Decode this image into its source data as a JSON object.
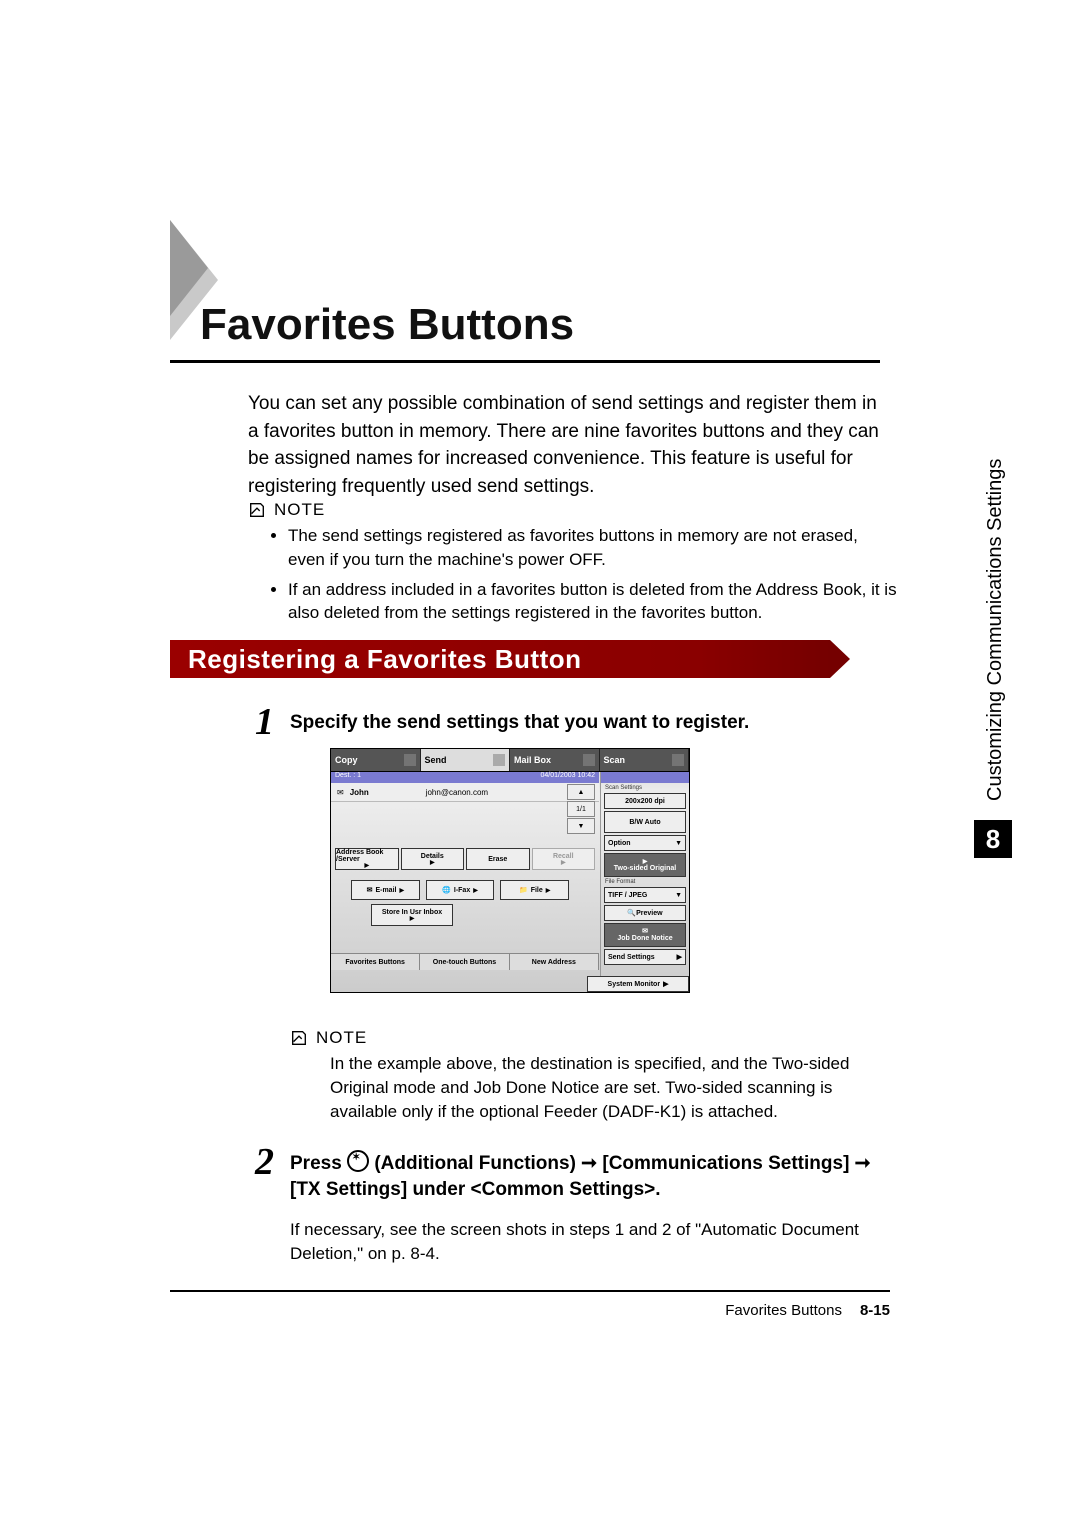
{
  "title": "Favorites Buttons",
  "intro": "You can set any possible combination of send settings and register them in a favorites button in memory. There are nine favorites buttons and they can be assigned names for increased convenience. This feature is useful for registering frequently used send settings.",
  "note_label": "NOTE",
  "note1_items": [
    "The send settings registered as favorites buttons in memory are not erased, even if you turn the machine's power OFF.",
    "If an address included in a favorites button is deleted from the Address Book, it is also deleted from the settings registered in the favorites button."
  ],
  "section_heading": "Registering a Favorites Button",
  "step1": {
    "number": "1",
    "heading": "Specify the send settings that you want to register."
  },
  "note2_text": "In the example above, the destination is specified, and the Two-sided Original mode and Job Done Notice are set. Two-sided scanning is available only if the optional Feeder (DADF-K1) is attached.",
  "step2": {
    "number": "2",
    "heading_pre": "Press ",
    "heading_mid": " (Additional Functions) ➞ [Communications Settings] ➞ [TX Settings] under <Common Settings>.",
    "body": "If necessary, see the screen shots in steps 1 and 2 of \"Automatic Document Deletion,\" on p. 8-4."
  },
  "chapter_number": "8",
  "side_label": "Customizing Communications Settings",
  "footer_title": "Favorites Buttons",
  "page_number": "8-15",
  "screenshot": {
    "tabs": {
      "copy": "Copy",
      "send": "Send",
      "mailbox": "Mail Box",
      "scan": "Scan"
    },
    "dest_label": "Dest. :   1",
    "date": "04/01/2003 10:42",
    "dest_name": "John",
    "dest_addr": "john@canon.com",
    "pager": {
      "mid": "1/1"
    },
    "main_btns": {
      "address_book": "Address Book /Server",
      "details": "Details",
      "erase": "Erase",
      "recall": "Recall"
    },
    "type_btns": {
      "email": "E-mail",
      "ifax": "I-Fax",
      "file": "File"
    },
    "store": "Store In Usr Inbox",
    "bottom": {
      "fav": "Favorites Buttons",
      "one": "One-touch Buttons",
      "new": "New Address"
    },
    "side": {
      "scan_settings": "Scan Settings",
      "res": "200x200 dpi",
      "mode": "B/W Auto",
      "option": "Option",
      "twosided": "Two-sided Original",
      "file_format": "File Format",
      "tiffjpeg": "TIFF / JPEG",
      "preview": "Preview",
      "jobdone": "Job Done Notice",
      "send_settings": "Send Settings"
    },
    "system_monitor": "System Monitor"
  }
}
